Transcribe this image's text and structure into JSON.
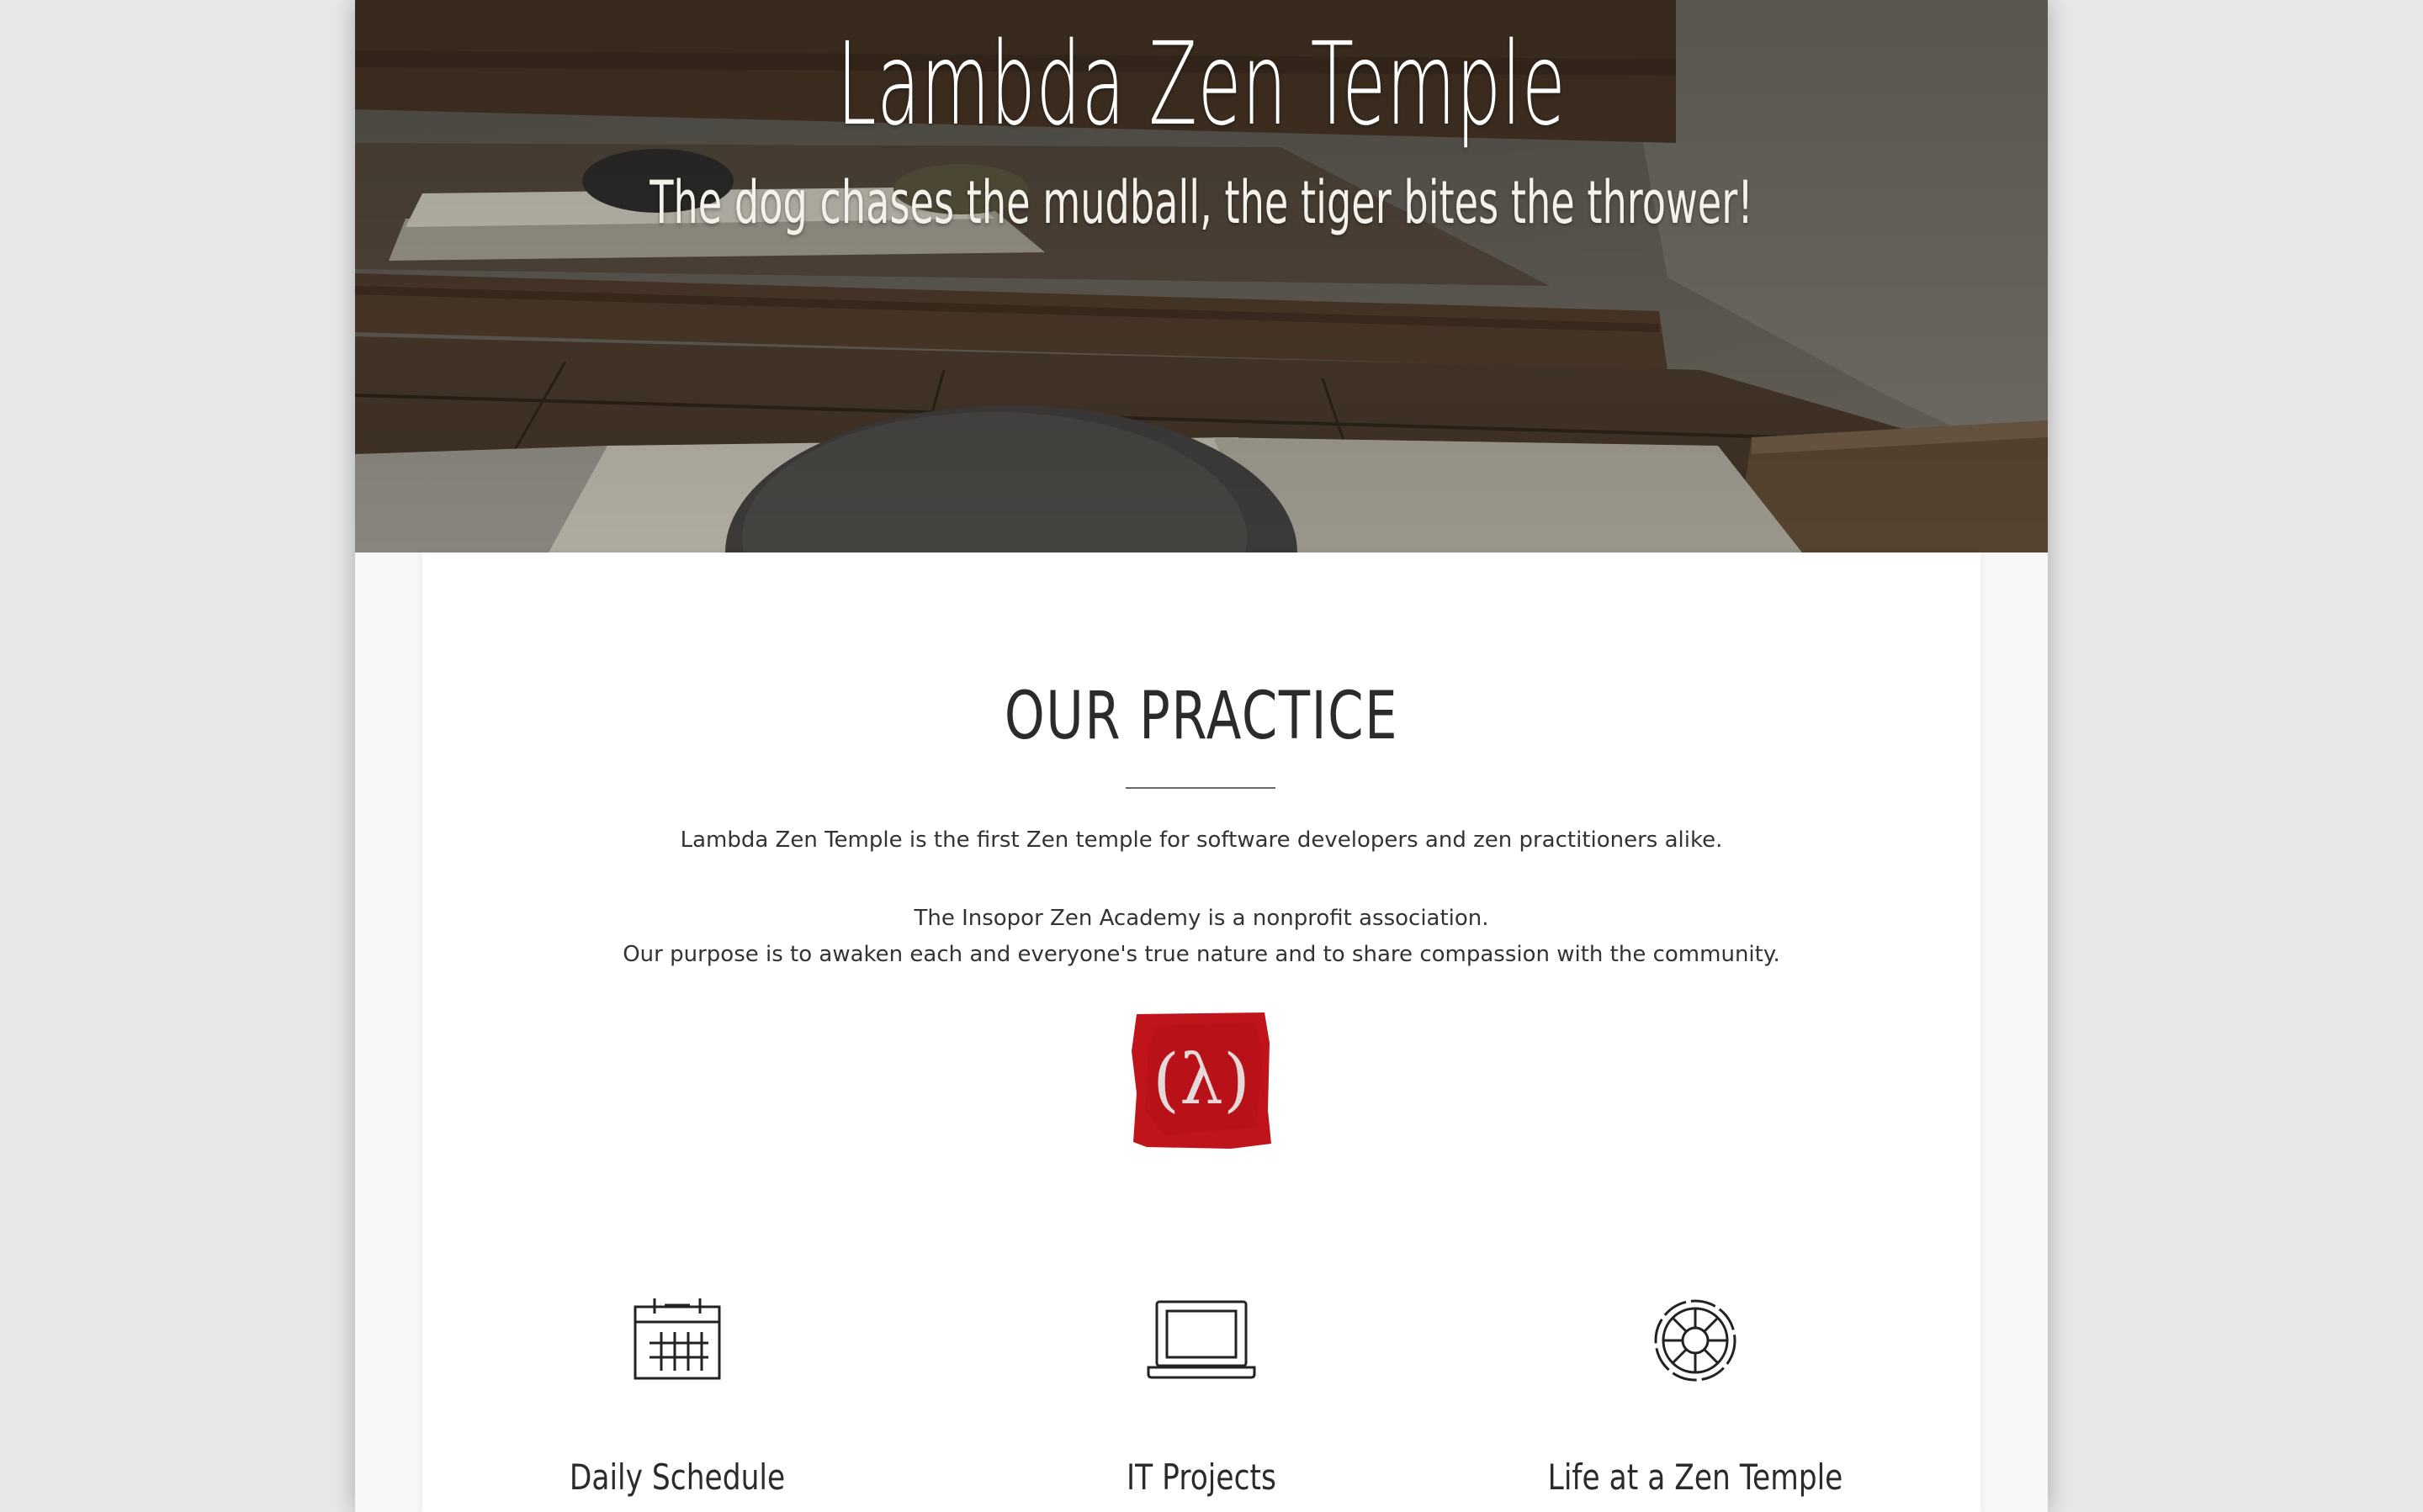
{
  "hero": {
    "title": "Lambda Zen Temple",
    "tagline": "The dog chases the mudball, the tiger bites the thrower!"
  },
  "practice": {
    "heading": "OUR PRACTICE",
    "intro": "Lambda Zen Temple is the first Zen temple for software developers and zen practitioners alike.",
    "association": "The Insopor Zen Academy is a nonprofit association.",
    "purpose": "Our purpose is to awaken each and everyone's true nature and to share compassion with the community.",
    "logo_text": "(λ)"
  },
  "features": [
    {
      "icon": "calendar-icon",
      "label": "Daily Schedule"
    },
    {
      "icon": "laptop-icon",
      "label": "IT Projects"
    },
    {
      "icon": "dharma-wheel-icon",
      "label": "Life at a Zen Temple"
    }
  ],
  "colors": {
    "page_background": "#e8e8e8",
    "card_background": "#ffffff",
    "logo_red": "#c0141b",
    "text_dark": "#2b2b2b"
  }
}
